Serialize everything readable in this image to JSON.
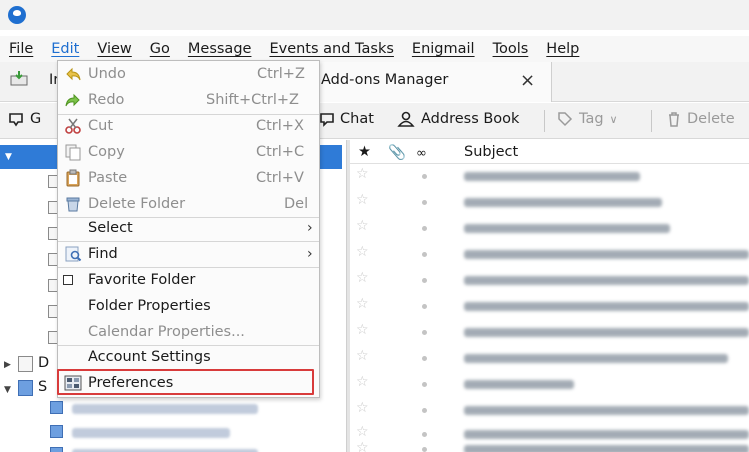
{
  "menubar": {
    "items": [
      "File",
      "Edit",
      "View",
      "Go",
      "Message",
      "Events and Tasks",
      "Enigmail",
      "Tools",
      "Help"
    ]
  },
  "tabs": {
    "first_partial": "Ir",
    "addons": "Add-ons Manager",
    "close": "×"
  },
  "toolbar": {
    "first_partial": "G",
    "chat": "Chat",
    "address_book": "Address Book",
    "tag": "Tag",
    "delete": "Delete"
  },
  "folder_pane": {
    "partial_d": "D",
    "partial_s": "S"
  },
  "message_list": {
    "subject_header": "Subject"
  },
  "edit_menu": {
    "items": [
      {
        "label": "Undo",
        "shortcut": "Ctrl+Z",
        "enabled": false
      },
      {
        "label": "Redo",
        "shortcut": "Shift+Ctrl+Z",
        "enabled": false
      },
      {
        "label": "Cut",
        "shortcut": "Ctrl+X",
        "enabled": false
      },
      {
        "label": "Copy",
        "shortcut": "Ctrl+C",
        "enabled": false
      },
      {
        "label": "Paste",
        "shortcut": "Ctrl+V",
        "enabled": false
      },
      {
        "label": "Delete Folder",
        "shortcut": "Del",
        "enabled": false
      },
      {
        "label": "Select",
        "shortcut": "",
        "enabled": true
      },
      {
        "label": "Find",
        "shortcut": "",
        "enabled": true
      },
      {
        "label": "Favorite Folder",
        "shortcut": "",
        "enabled": true
      },
      {
        "label": "Folder Properties",
        "shortcut": "",
        "enabled": true
      },
      {
        "label": "Calendar Properties...",
        "shortcut": "",
        "enabled": false
      },
      {
        "label": "Account Settings",
        "shortcut": "",
        "enabled": true
      },
      {
        "label": "Preferences",
        "shortcut": "",
        "enabled": true
      }
    ]
  },
  "colors": {
    "accent": "#1f6fd0",
    "selection": "#2f7bd7",
    "highlight_border": "#d83b3b"
  }
}
